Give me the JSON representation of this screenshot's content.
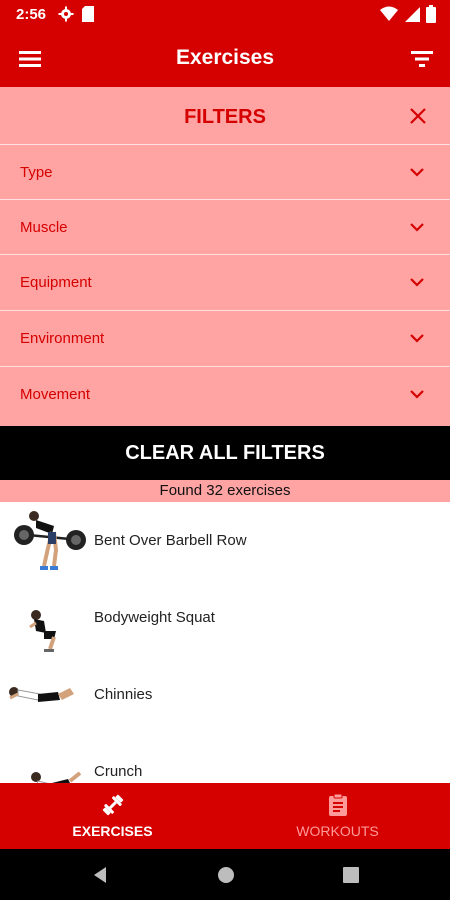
{
  "status_bar": {
    "time": "2:56",
    "icons": [
      "settings-icon",
      "sd-card-icon",
      "wifi-icon",
      "signal-icon",
      "battery-icon"
    ]
  },
  "app_bar": {
    "title": "Exercises",
    "left_icon": "menu-icon",
    "right_icon": "filter-list-icon"
  },
  "filters": {
    "title": "FILTERS",
    "close_icon": "close-icon",
    "rows": [
      {
        "label": "Type",
        "icon": "chevron-down-icon"
      },
      {
        "label": "Muscle",
        "icon": "chevron-down-icon"
      },
      {
        "label": "Equipment",
        "icon": "chevron-down-icon"
      },
      {
        "label": "Environment",
        "icon": "chevron-down-icon"
      },
      {
        "label": "Movement",
        "icon": "chevron-down-icon"
      }
    ],
    "clear_label": "CLEAR ALL FILTERS"
  },
  "results": {
    "found_text": "Found 32 exercises",
    "items": [
      {
        "name": "Bent Over Barbell Row"
      },
      {
        "name": "Bodyweight Squat"
      },
      {
        "name": "Chinnies"
      },
      {
        "name": "Crunch"
      }
    ]
  },
  "bottom_nav": {
    "items": [
      {
        "label": "EXERCISES",
        "icon": "dumbbell-icon",
        "active": true
      },
      {
        "label": "WORKOUTS",
        "icon": "clipboard-icon",
        "active": false
      }
    ]
  },
  "system_nav": {
    "icons": [
      "back-icon",
      "home-icon",
      "recents-icon"
    ]
  },
  "colors": {
    "primary": "#d50000",
    "filter_bg": "#ffa3a3",
    "inactive_nav": "#ff9a9a",
    "clear_bg": "#000000"
  }
}
